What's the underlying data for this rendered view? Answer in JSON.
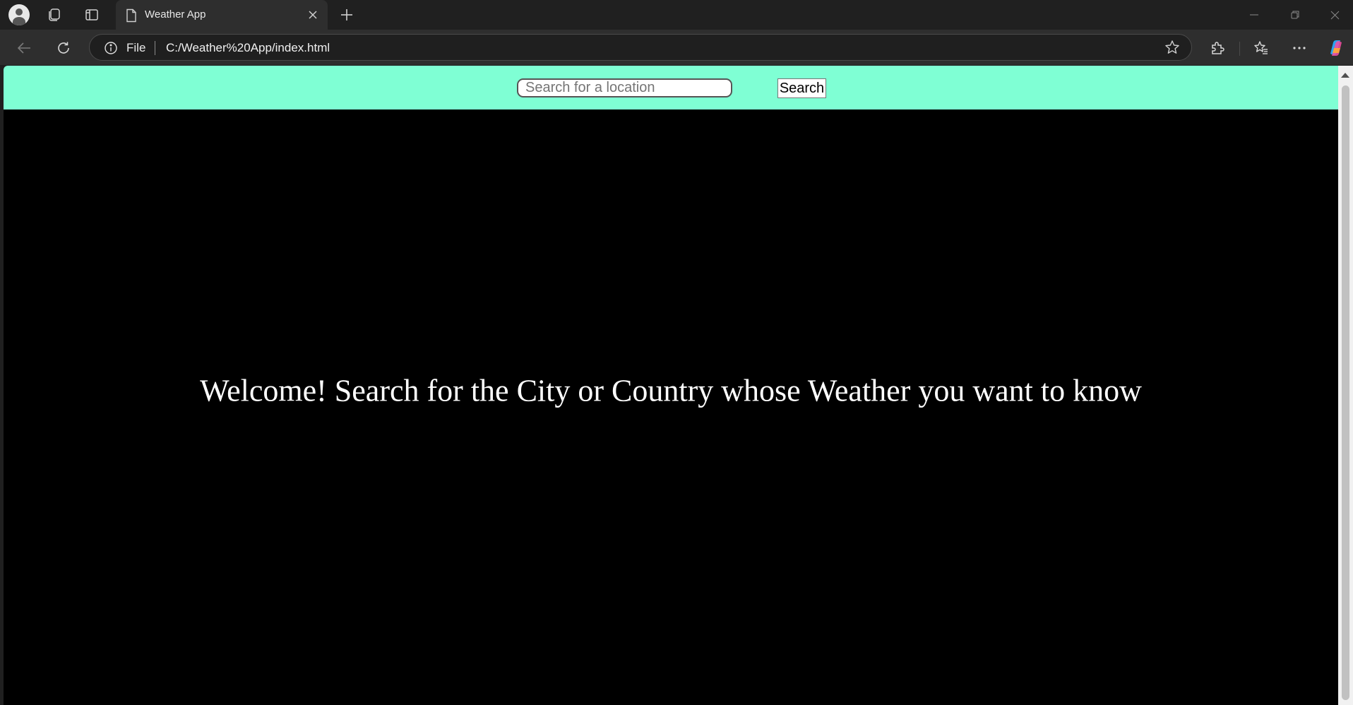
{
  "browser": {
    "tab": {
      "title": "Weather App",
      "icon": "page-icon"
    },
    "address_bar": {
      "scheme_label": "File",
      "url": "C:/Weather%20App/index.html"
    },
    "icons": [
      "profile-icon",
      "collections-icon",
      "vertical-tabs-icon",
      "page-icon",
      "close-tab-icon",
      "new-tab-icon",
      "minimize-icon",
      "restore-icon",
      "close-window-icon",
      "back-icon",
      "reload-icon",
      "info-icon",
      "favorite-star-icon",
      "extensions-icon",
      "favorites-icon",
      "more-icon",
      "copilot-icon"
    ]
  },
  "app": {
    "header_color": "#7fffd4",
    "search": {
      "placeholder": "Search for a location",
      "value": "",
      "button_label": "Search"
    },
    "welcome_message": "Welcome! Search for the City or Country whose Weather you want to know"
  }
}
